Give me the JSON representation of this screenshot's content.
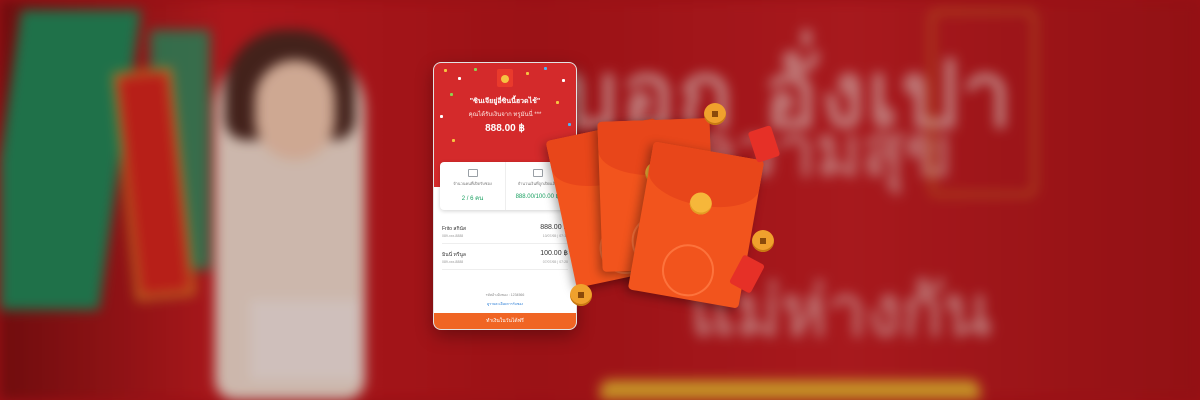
{
  "phone": {
    "hero": {
      "title": "\"ซินเจียยู่อี่ซินนี้ฮวดไช้\"",
      "subtitle": "คุณได้รับเงินจาก ทรูมันนี่ ***",
      "amount": "888.00 ฿"
    },
    "stats": [
      {
        "label": "จำนวนคนที่เปิดรับซอง",
        "value": "2 / 6 คน"
      },
      {
        "label": "จำนวนเงินที่ถูกเปิดแล้ว",
        "value": "888.00/100.00 ฿"
      }
    ],
    "claims": [
      {
        "name": "Frito สกินัส",
        "id": "089-xxx-8888",
        "amount": "888.00 ฿",
        "time": "10/07/65 | 07:15"
      },
      {
        "name": "มินนี่ ทรีนูล",
        "id": "089-xxx-8888",
        "amount": "100.00 ฿",
        "time": "07/07/65 | 07:20"
      }
    ],
    "footer_note": "รหัสอ้างอิงซอง : 1234566",
    "footer_link": "ดูรายละเอียดการรับซอง",
    "cta_label": "ทำเงินในวันได้ฟรี"
  },
  "background": {
    "headline_1": "บอก อั่งเปา",
    "headline_2": "ความสุข",
    "headline_3": "แม่ห่างกัน"
  },
  "colors": {
    "hero_red": "#d42a2b",
    "cta_orange": "#f06524",
    "accent_green": "#1aa061",
    "packet_orange": "#f2541d"
  }
}
